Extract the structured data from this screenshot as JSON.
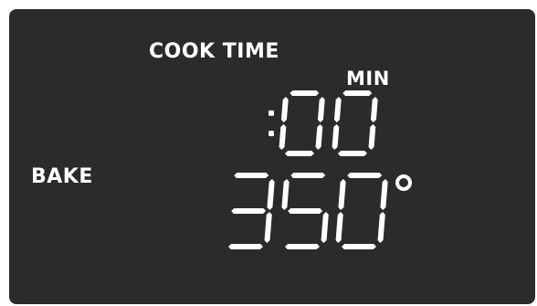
{
  "display": {
    "cook_time_label": "COOK TIME",
    "time_unit": "MIN",
    "time_value": ":00",
    "mode_label": "BAKE",
    "temperature_value": "350",
    "temperature_symbol": "°"
  },
  "colors": {
    "panel_background": "#2b2b2b",
    "segment_color": "#ffffff",
    "page_background": "#ffffff"
  }
}
